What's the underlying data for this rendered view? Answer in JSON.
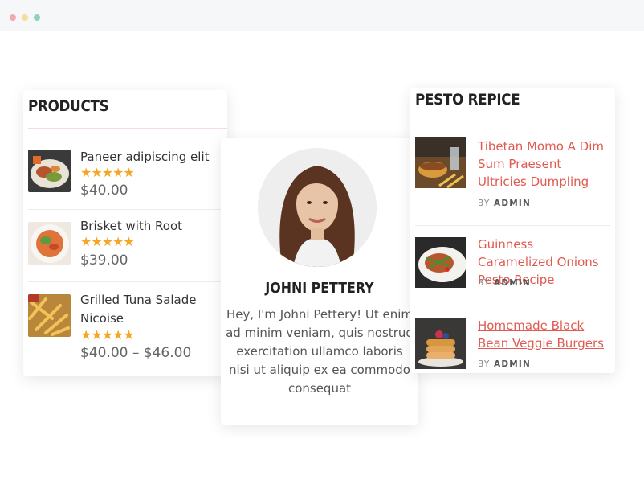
{
  "products": {
    "title": "PRODUCTS",
    "items": [
      {
        "name": "Paneer adipiscing elit",
        "stars": "★★★★★",
        "price": "$40.00"
      },
      {
        "name": "Brisket with Root",
        "stars": "★★★★★",
        "price": "$39.00"
      },
      {
        "name": "Grilled Tuna Salade Nicoise",
        "stars": "★★★★★",
        "price": "$40.00 – $46.00"
      }
    ]
  },
  "author": {
    "name": "JOHNI PETTERY",
    "bio": "Hey, I'm Johni Pettery! Ut enim ad minim veniam, quis nostrud exercitation ullamco laboris nisi ut aliquip ex ea commodo consequat"
  },
  "pesto": {
    "title": "PESTO REPICE",
    "by_label": "BY",
    "posts": [
      {
        "title": "Tibetan Momo A Dim Sum Praesent Ultricies Dumpling",
        "author": "ADMIN"
      },
      {
        "title": "Guinness Caramelized Onions Pesto Recipe",
        "author": "ADMIN"
      },
      {
        "title": "Homemade Black Bean Veggie Burgers",
        "author": "ADMIN"
      }
    ]
  },
  "colors": {
    "accent": "#e05a50",
    "star": "#f5a623",
    "rule": "#f3dede"
  }
}
